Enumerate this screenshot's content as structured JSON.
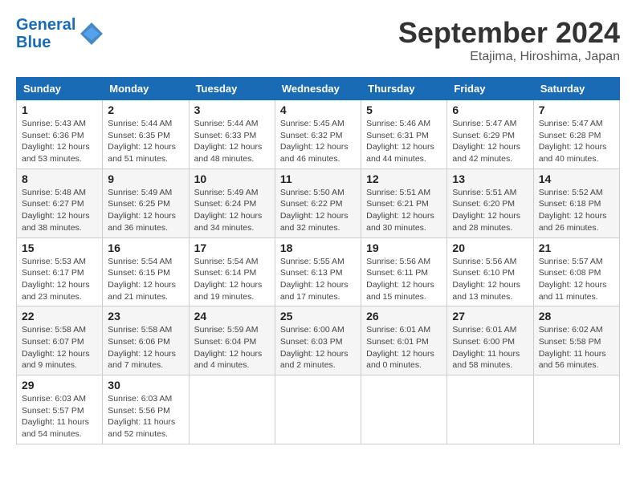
{
  "logo": {
    "line1": "General",
    "line2": "Blue"
  },
  "title": "September 2024",
  "location": "Etajima, Hiroshima, Japan",
  "weekdays": [
    "Sunday",
    "Monday",
    "Tuesday",
    "Wednesday",
    "Thursday",
    "Friday",
    "Saturday"
  ],
  "weeks": [
    [
      {
        "day": "1",
        "sunrise": "5:43 AM",
        "sunset": "6:36 PM",
        "daylight": "12 hours and 53 minutes."
      },
      {
        "day": "2",
        "sunrise": "5:44 AM",
        "sunset": "6:35 PM",
        "daylight": "12 hours and 51 minutes."
      },
      {
        "day": "3",
        "sunrise": "5:44 AM",
        "sunset": "6:33 PM",
        "daylight": "12 hours and 48 minutes."
      },
      {
        "day": "4",
        "sunrise": "5:45 AM",
        "sunset": "6:32 PM",
        "daylight": "12 hours and 46 minutes."
      },
      {
        "day": "5",
        "sunrise": "5:46 AM",
        "sunset": "6:31 PM",
        "daylight": "12 hours and 44 minutes."
      },
      {
        "day": "6",
        "sunrise": "5:47 AM",
        "sunset": "6:29 PM",
        "daylight": "12 hours and 42 minutes."
      },
      {
        "day": "7",
        "sunrise": "5:47 AM",
        "sunset": "6:28 PM",
        "daylight": "12 hours and 40 minutes."
      }
    ],
    [
      {
        "day": "8",
        "sunrise": "5:48 AM",
        "sunset": "6:27 PM",
        "daylight": "12 hours and 38 minutes."
      },
      {
        "day": "9",
        "sunrise": "5:49 AM",
        "sunset": "6:25 PM",
        "daylight": "12 hours and 36 minutes."
      },
      {
        "day": "10",
        "sunrise": "5:49 AM",
        "sunset": "6:24 PM",
        "daylight": "12 hours and 34 minutes."
      },
      {
        "day": "11",
        "sunrise": "5:50 AM",
        "sunset": "6:22 PM",
        "daylight": "12 hours and 32 minutes."
      },
      {
        "day": "12",
        "sunrise": "5:51 AM",
        "sunset": "6:21 PM",
        "daylight": "12 hours and 30 minutes."
      },
      {
        "day": "13",
        "sunrise": "5:51 AM",
        "sunset": "6:20 PM",
        "daylight": "12 hours and 28 minutes."
      },
      {
        "day": "14",
        "sunrise": "5:52 AM",
        "sunset": "6:18 PM",
        "daylight": "12 hours and 26 minutes."
      }
    ],
    [
      {
        "day": "15",
        "sunrise": "5:53 AM",
        "sunset": "6:17 PM",
        "daylight": "12 hours and 23 minutes."
      },
      {
        "day": "16",
        "sunrise": "5:54 AM",
        "sunset": "6:15 PM",
        "daylight": "12 hours and 21 minutes."
      },
      {
        "day": "17",
        "sunrise": "5:54 AM",
        "sunset": "6:14 PM",
        "daylight": "12 hours and 19 minutes."
      },
      {
        "day": "18",
        "sunrise": "5:55 AM",
        "sunset": "6:13 PM",
        "daylight": "12 hours and 17 minutes."
      },
      {
        "day": "19",
        "sunrise": "5:56 AM",
        "sunset": "6:11 PM",
        "daylight": "12 hours and 15 minutes."
      },
      {
        "day": "20",
        "sunrise": "5:56 AM",
        "sunset": "6:10 PM",
        "daylight": "12 hours and 13 minutes."
      },
      {
        "day": "21",
        "sunrise": "5:57 AM",
        "sunset": "6:08 PM",
        "daylight": "12 hours and 11 minutes."
      }
    ],
    [
      {
        "day": "22",
        "sunrise": "5:58 AM",
        "sunset": "6:07 PM",
        "daylight": "12 hours and 9 minutes."
      },
      {
        "day": "23",
        "sunrise": "5:58 AM",
        "sunset": "6:06 PM",
        "daylight": "12 hours and 7 minutes."
      },
      {
        "day": "24",
        "sunrise": "5:59 AM",
        "sunset": "6:04 PM",
        "daylight": "12 hours and 4 minutes."
      },
      {
        "day": "25",
        "sunrise": "6:00 AM",
        "sunset": "6:03 PM",
        "daylight": "12 hours and 2 minutes."
      },
      {
        "day": "26",
        "sunrise": "6:01 AM",
        "sunset": "6:01 PM",
        "daylight": "12 hours and 0 minutes."
      },
      {
        "day": "27",
        "sunrise": "6:01 AM",
        "sunset": "6:00 PM",
        "daylight": "11 hours and 58 minutes."
      },
      {
        "day": "28",
        "sunrise": "6:02 AM",
        "sunset": "5:58 PM",
        "daylight": "11 hours and 56 minutes."
      }
    ],
    [
      {
        "day": "29",
        "sunrise": "6:03 AM",
        "sunset": "5:57 PM",
        "daylight": "11 hours and 54 minutes."
      },
      {
        "day": "30",
        "sunrise": "6:03 AM",
        "sunset": "5:56 PM",
        "daylight": "11 hours and 52 minutes."
      },
      null,
      null,
      null,
      null,
      null
    ]
  ]
}
